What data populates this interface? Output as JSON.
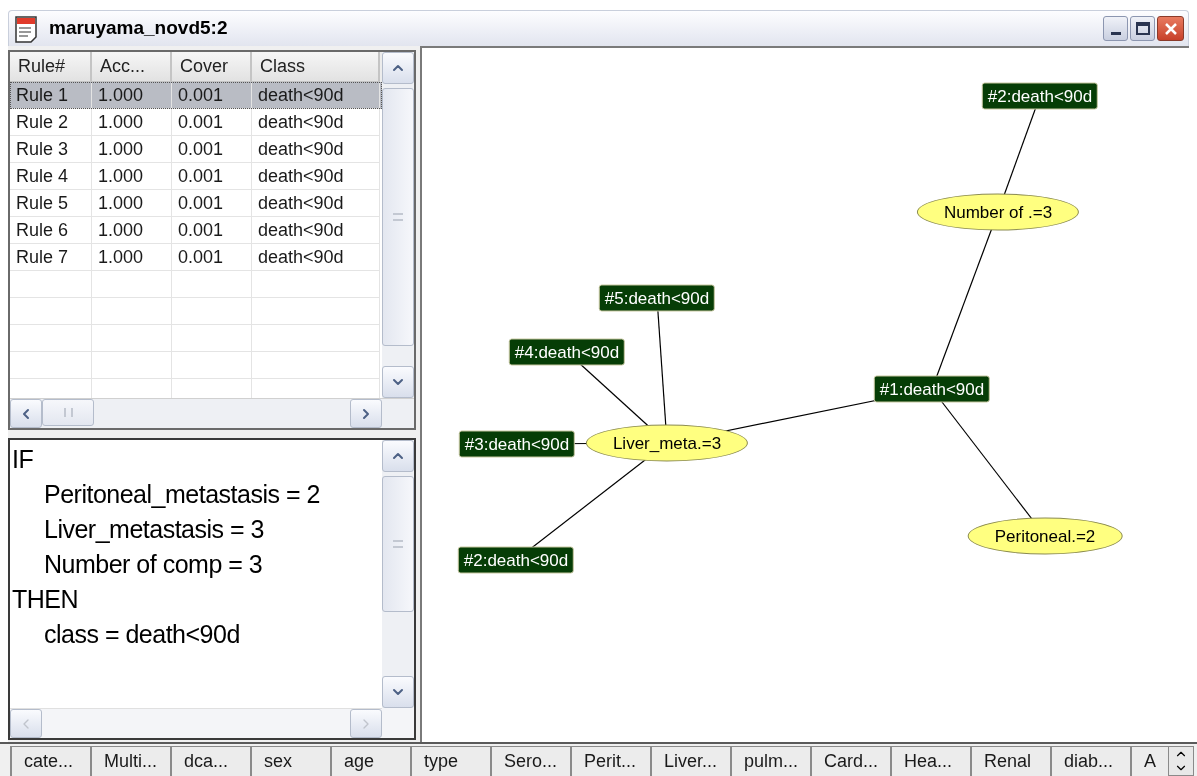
{
  "window": {
    "title": "maruyama_novd5:2"
  },
  "rules_table": {
    "columns": [
      "Rule#",
      "Acc...",
      "Cover",
      "Class"
    ],
    "rows": [
      {
        "cells": [
          "Rule 1",
          "1.000",
          "0.001",
          "death<90d"
        ],
        "selected": true
      },
      {
        "cells": [
          "Rule 2",
          "1.000",
          "0.001",
          "death<90d"
        ],
        "selected": false
      },
      {
        "cells": [
          "Rule 3",
          "1.000",
          "0.001",
          "death<90d"
        ],
        "selected": false
      },
      {
        "cells": [
          "Rule 4",
          "1.000",
          "0.001",
          "death<90d"
        ],
        "selected": false
      },
      {
        "cells": [
          "Rule 5",
          "1.000",
          "0.001",
          "death<90d"
        ],
        "selected": false
      },
      {
        "cells": [
          "Rule 6",
          "1.000",
          "0.001",
          "death<90d"
        ],
        "selected": false
      },
      {
        "cells": [
          "Rule 7",
          "1.000",
          "0.001",
          "death<90d"
        ],
        "selected": false
      }
    ]
  },
  "rule_text": [
    {
      "kind": "keyword",
      "text": "IF"
    },
    {
      "kind": "clause",
      "text": "Peritoneal_metastasis = 2"
    },
    {
      "kind": "clause",
      "text": "Liver_metastasis = 3"
    },
    {
      "kind": "clause",
      "text": "Number of comp = 3"
    },
    {
      "kind": "keyword",
      "text": "THEN"
    },
    {
      "kind": "clause",
      "text": "class = death<90d"
    }
  ],
  "graph": {
    "root": {
      "kind": "condition",
      "label": "Number of .=3",
      "children": [
        {
          "kind": "class",
          "label": "#2:death<90d"
        },
        {
          "kind": "class",
          "label": "#1:death<90d",
          "children": [
            {
              "kind": "condition",
              "label": "Peritoneal.=2"
            },
            {
              "kind": "condition",
              "label": "Liver_meta.=3",
              "children": [
                {
                  "kind": "class",
                  "label": "#5:death<90d"
                },
                {
                  "kind": "class",
                  "label": "#4:death<90d"
                },
                {
                  "kind": "class",
                  "label": "#3:death<90d"
                },
                {
                  "kind": "class",
                  "label": "#2:death<90d"
                }
              ]
            }
          ]
        }
      ]
    }
  },
  "attribute_tabs": [
    "cate...",
    "Multi...",
    "dca...",
    "sex",
    "age",
    "type",
    "Sero...",
    "Perit...",
    "Liver...",
    "pulm...",
    "Card...",
    "Hea...",
    "Renal",
    "diab...",
    "A"
  ]
}
